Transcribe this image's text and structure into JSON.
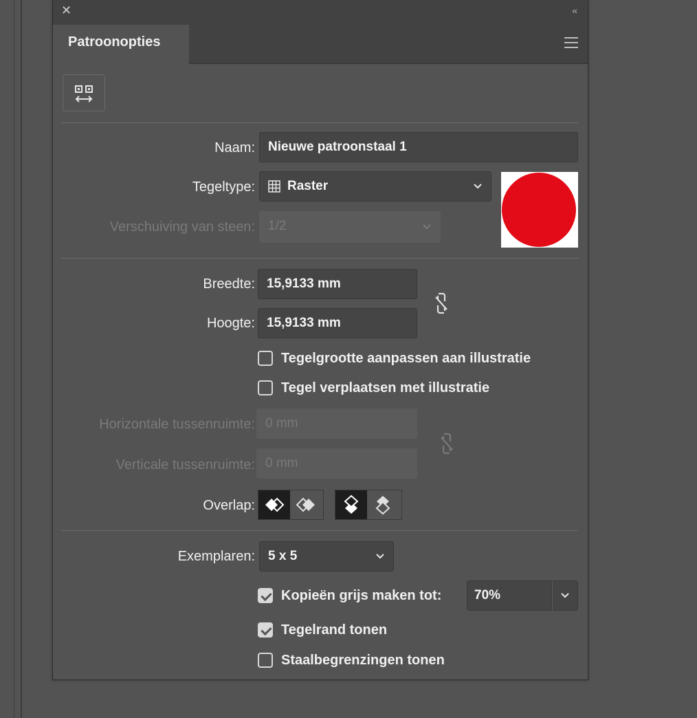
{
  "panel": {
    "close_glyph": "✕",
    "collapse_glyph": "‹‹",
    "tab_label": "Patroonopties"
  },
  "form": {
    "name_label": "Naam:",
    "name_value": "Nieuwe patroonstaal 1",
    "tiletype_label": "Tegeltype:",
    "tiletype_value": "Raster",
    "offset_label": "Verschuiving van steen:",
    "offset_value": "1/2",
    "width_label": "Breedte:",
    "width_value": "15,9133 mm",
    "height_label": "Hoogte:",
    "height_value": "15,9133 mm",
    "fit_tile_label": "Tegelgrootte aanpassen aan illustratie",
    "move_tile_label": "Tegel verplaatsen met illustratie",
    "h_spacing_label": "Horizontale tussenruimte:",
    "h_spacing_value": "0 mm",
    "v_spacing_label": "Verticale tussenruimte:",
    "v_spacing_value": "0 mm",
    "overlap_label": "Overlap:",
    "copies_label": "Exemplaren:",
    "copies_value": "5 x 5",
    "dim_copies_label": "Kopieën grijs maken tot:",
    "dim_copies_value": "70%",
    "show_tile_edge_label": "Tegelrand tonen",
    "show_swatch_bounds_label": "Staalbegrenzingen tonen"
  },
  "checkboxes": {
    "fit_tile": false,
    "move_tile": false,
    "dim_copies": true,
    "show_tile_edge": true,
    "show_swatch_bounds": false
  },
  "colors": {
    "swatch_fill": "#e30b17",
    "panel_bg": "#535353"
  }
}
